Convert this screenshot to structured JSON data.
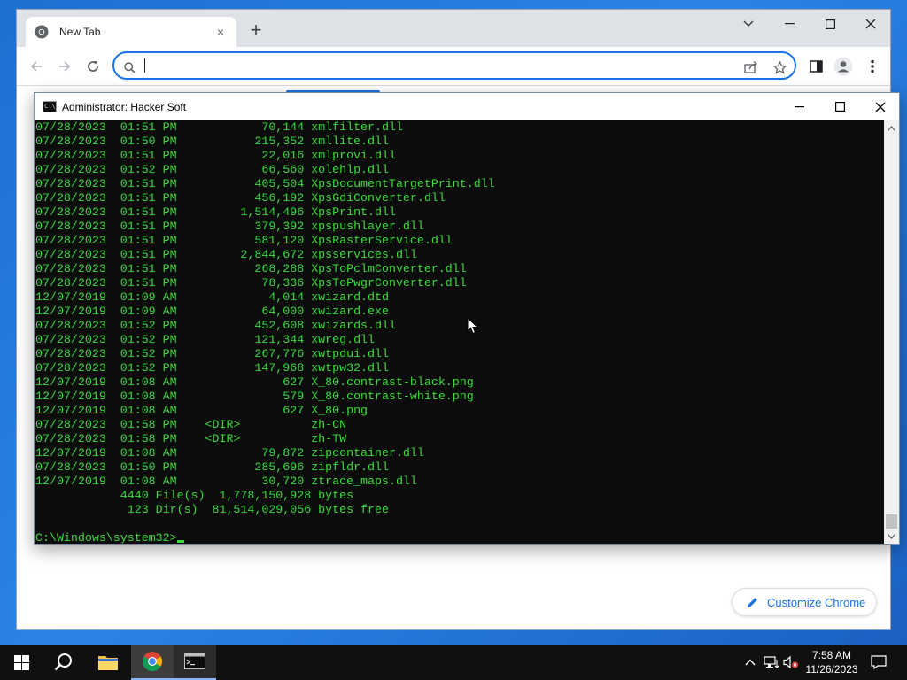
{
  "chrome": {
    "tab_title": "New Tab",
    "new_tab_glyph": "+",
    "tab_close_glyph": "×",
    "omnibox_value": "",
    "customize_label": "Customize Chrome",
    "accent_color": "#1a73e8"
  },
  "console": {
    "title": "Administrator:  Hacker Soft",
    "icon_label": "C:\\_",
    "text_color": "#3fd93f",
    "background": "#0c0c0c",
    "lines": [
      "07/28/2023  01:51 PM            70,144 xmlfilter.dll",
      "07/28/2023  01:50 PM           215,352 xmllite.dll",
      "07/28/2023  01:51 PM            22,016 xmlprovi.dll",
      "07/28/2023  01:52 PM            66,560 xolehlp.dll",
      "07/28/2023  01:51 PM           405,504 XpsDocumentTargetPrint.dll",
      "07/28/2023  01:51 PM           456,192 XpsGdiConverter.dll",
      "07/28/2023  01:51 PM         1,514,496 XpsPrint.dll",
      "07/28/2023  01:51 PM           379,392 xpspushlayer.dll",
      "07/28/2023  01:51 PM           581,120 XpsRasterService.dll",
      "07/28/2023  01:51 PM         2,844,672 xpsservices.dll",
      "07/28/2023  01:51 PM           268,288 XpsToPclmConverter.dll",
      "07/28/2023  01:51 PM            78,336 XpsToPwgrConverter.dll",
      "12/07/2019  01:09 AM             4,014 xwizard.dtd",
      "12/07/2019  01:09 AM            64,000 xwizard.exe",
      "07/28/2023  01:52 PM           452,608 xwizards.dll",
      "07/28/2023  01:52 PM           121,344 xwreg.dll",
      "07/28/2023  01:52 PM           267,776 xwtpdui.dll",
      "07/28/2023  01:52 PM           147,968 xwtpw32.dll",
      "12/07/2019  01:08 AM               627 X_80.contrast-black.png",
      "12/07/2019  01:08 AM               579 X_80.contrast-white.png",
      "12/07/2019  01:08 AM               627 X_80.png",
      "07/28/2023  01:58 PM    <DIR>          zh-CN",
      "07/28/2023  01:58 PM    <DIR>          zh-TW",
      "12/07/2019  01:08 AM            79,872 zipcontainer.dll",
      "07/28/2023  01:50 PM           285,696 zipfldr.dll",
      "12/07/2019  01:08 AM            30,720 ztrace_maps.dll",
      "            4440 File(s)  1,778,150,928 bytes",
      "             123 Dir(s)  81,514,029,056 bytes free"
    ],
    "prompt": "C:\\Windows\\system32>"
  },
  "taskbar": {
    "time": "7:58 AM",
    "date": "11/26/2023"
  }
}
